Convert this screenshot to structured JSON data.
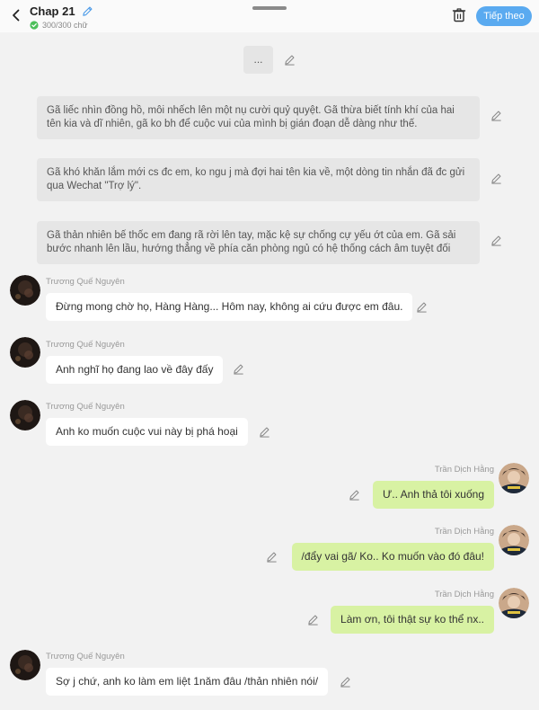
{
  "header": {
    "chapter_title": "Chap 21",
    "char_count": "300/300 chữ",
    "next_label": "Tiếp theo"
  },
  "ellipsis": "...",
  "narrations": [
    "Gã liếc nhìn đồng hồ, môi nhếch lên một nụ cười quỷ quyệt. Gã thừa biết tính khí của hai tên kia và dĩ nhiên, gã ko bh để cuộc vui của mình bị gián đoạn dễ dàng như thế.",
    "Gã khó khăn lắm mới cs đc em, ko ngu j mà đợi hai tên kia về, một dòng tin nhắn đã đc gửi qua Wechat \"Trợ lý\".",
    "Gã thản nhiên bế thốc em đang rã rời lên tay, mặc kệ sự chống cự yếu ớt của em. Gã sải bước nhanh lên lầu, hướng thẳng về phía căn phòng ngủ có hệ thống cách âm tuyệt đối"
  ],
  "messages": [
    {
      "sender": "Trương Quế Nguyên",
      "text": "Đừng mong chờ họ, Hàng Hàng... Hôm nay, không ai cứu được em đâu."
    },
    {
      "sender": "Trương Quế Nguyên",
      "text": "Anh nghĩ họ đang lao về đây đấy"
    },
    {
      "sender": "Trương Quế Nguyên",
      "text": "Anh ko muốn cuộc vui này bị phá hoại"
    },
    {
      "sender": "Trần Dịch Hằng",
      "text": "Ư.. Anh thả tôi xuống"
    },
    {
      "sender": "Trần Dịch Hằng",
      "text": "/đẩy vai gã/ Ko.. Ko muốn vào đó đâu!"
    },
    {
      "sender": "Trần Dịch Hằng",
      "text": "Làm ơn, tôi thật sự ko thể nx.."
    },
    {
      "sender": "Trương Quế Nguyên",
      "text": "Sợ j chứ, anh ko làm em liệt 1năm đâu /thản nhiên nói/"
    }
  ],
  "colors": {
    "accent": "#5aaaf0",
    "right_bubble": "#d8f2a3",
    "left_bubble": "#ffffff",
    "background": "#f2f2f2"
  },
  "icons": [
    "back-icon",
    "pencil-icon",
    "check-icon",
    "trash-icon"
  ]
}
